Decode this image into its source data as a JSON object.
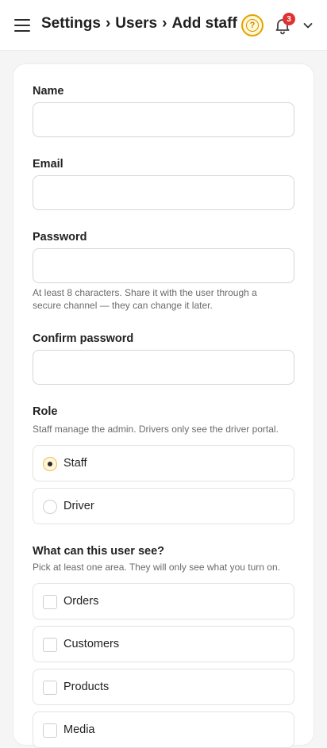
{
  "header": {
    "breadcrumb": [
      "Settings",
      "Users",
      "Add staff"
    ],
    "separator": "›",
    "notification_count": "3",
    "help_glyph": "?",
    "colors": {
      "help_accent": "#e2a300",
      "badge": "#e03131"
    }
  },
  "form": {
    "name": {
      "label": "Name",
      "value": "",
      "placeholder": ""
    },
    "email": {
      "label": "Email",
      "value": "",
      "placeholder": ""
    },
    "password": {
      "label": "Password",
      "value": "",
      "placeholder": "",
      "help_line1": "At least 8 characters. Share it with the user through a",
      "help_line2": "secure channel — they can change it later."
    },
    "confirm_password": {
      "label": "Confirm password",
      "value": "",
      "placeholder": ""
    },
    "role": {
      "label": "Role",
      "help": "Staff manage the admin. Drivers only see the driver portal.",
      "options": [
        {
          "label": "Staff",
          "selected": true
        },
        {
          "label": "Driver",
          "selected": false
        }
      ]
    },
    "visibility": {
      "label": "What can this user see?",
      "help": "Pick at least one area. They will only see what you turn on.",
      "areas": [
        {
          "label": "Orders",
          "checked": false
        },
        {
          "label": "Customers",
          "checked": false
        },
        {
          "label": "Products",
          "checked": false
        },
        {
          "label": "Media",
          "checked": false
        }
      ]
    }
  },
  "icons": {
    "menu": "menu-icon",
    "help": "help-circle-icon",
    "notifications": "bell-icon",
    "account_menu": "chevron-down-icon",
    "radio_checked": "radio-checked-icon",
    "radio_unchecked": "radio-unchecked-icon",
    "checkbox": "checkbox-icon"
  }
}
